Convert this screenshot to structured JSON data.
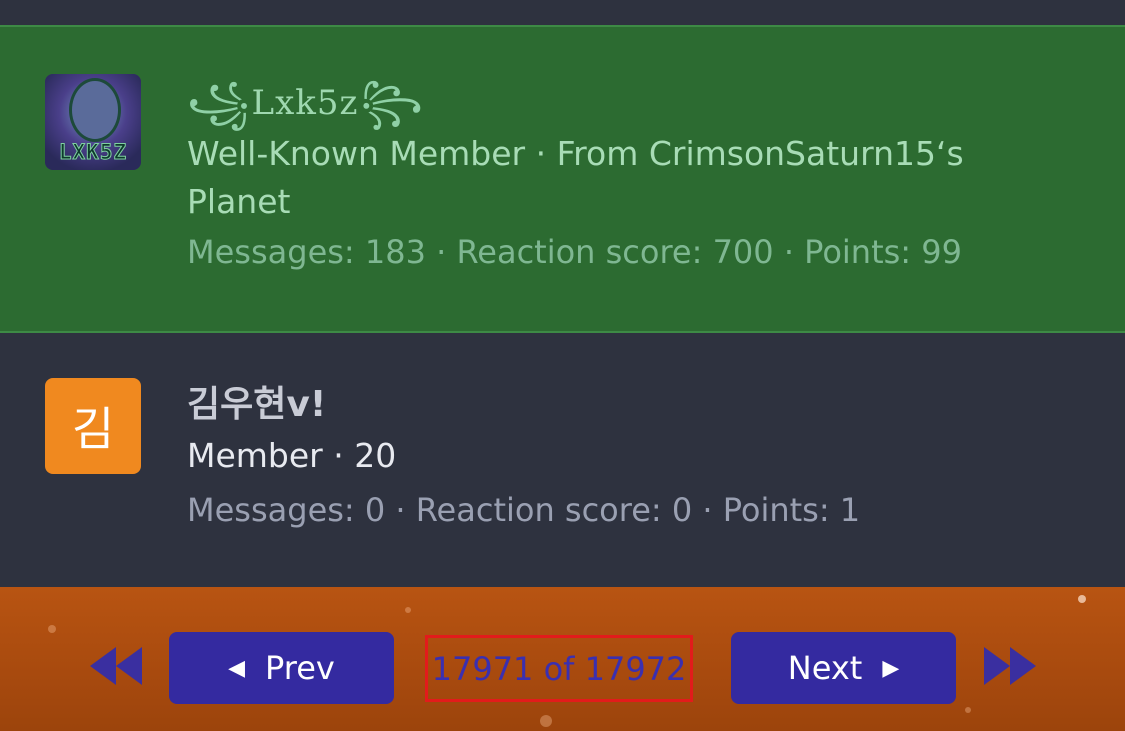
{
  "members": [
    {
      "username": "Lxk5z",
      "avatar_text": "LXK5Z",
      "title": "Well-Known Member · From CrimsonSaturn15‘s Planet",
      "stats": "Messages: 183 · Reaction score: 700 · Points: 99",
      "highlighted": true,
      "row_color": "#2c6b31"
    },
    {
      "username": "김우현v!",
      "avatar_letter": "김",
      "avatar_color": "#f0891f",
      "title": "Member · 20",
      "stats": "Messages: 0 · Reaction score: 0 · Points: 1"
    }
  ],
  "pagination": {
    "first_icon": "double-chevron-left-icon",
    "prev_label": "Prev",
    "indicator": "17971 of 17972",
    "next_label": "Next",
    "last_icon": "double-chevron-right-icon",
    "button_color": "#342aa0",
    "bar_color": "#b85412"
  }
}
